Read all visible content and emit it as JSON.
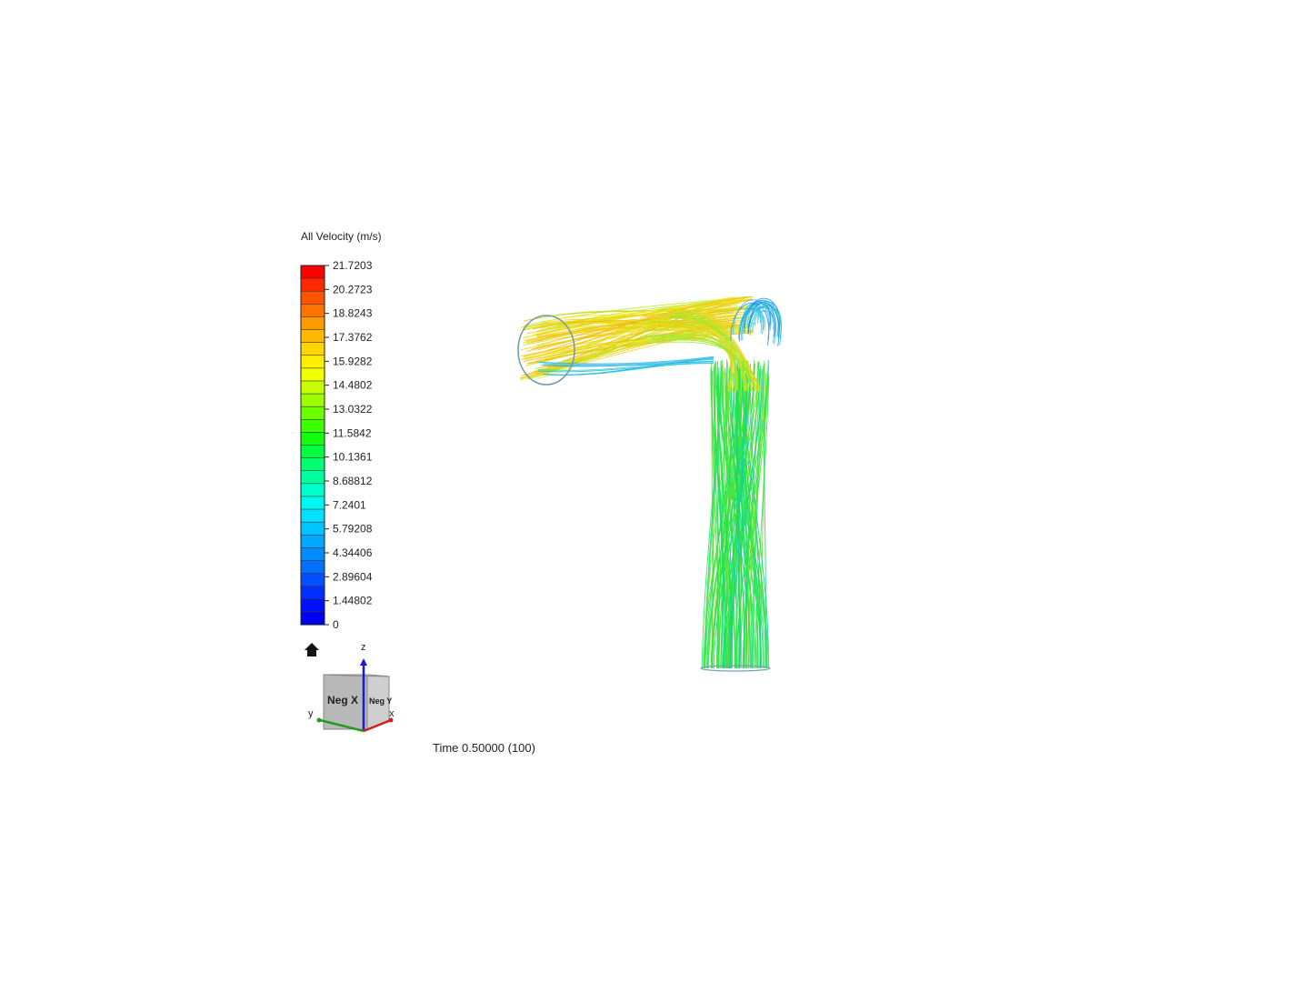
{
  "legend": {
    "title": "All Velocity (m/s)",
    "ticks": [
      "21.7203",
      "20.2723",
      "18.8243",
      "17.3762",
      "15.9282",
      "14.4802",
      "13.0322",
      "11.5842",
      "10.1361",
      "8.68812",
      "7.2401",
      "5.79208",
      "4.34406",
      "2.89604",
      "1.44802",
      "0"
    ],
    "colors": [
      "#ff0000",
      "#ff2a00",
      "#ff5500",
      "#ff7400",
      "#ff9a00",
      "#ffb900",
      "#ffd500",
      "#fff000",
      "#f0ff00",
      "#c8ff00",
      "#9cff00",
      "#6cff00",
      "#3cff00",
      "#14ff10",
      "#00ff40",
      "#00ff70",
      "#00ffa0",
      "#00ffcc",
      "#00f8f0",
      "#00e0ff",
      "#00c4ff",
      "#00a8ff",
      "#008cff",
      "#0070ff",
      "#0050ff",
      "#0030ff",
      "#0010ff",
      "#0000f0"
    ]
  },
  "orientation": {
    "face_front": "Neg X",
    "face_side": "Neg Y",
    "axis_x": "x",
    "axis_y": "y",
    "axis_z": "z"
  },
  "time": {
    "label": "Time 0.50000 (100)"
  },
  "icons": {
    "home": "home-icon"
  }
}
